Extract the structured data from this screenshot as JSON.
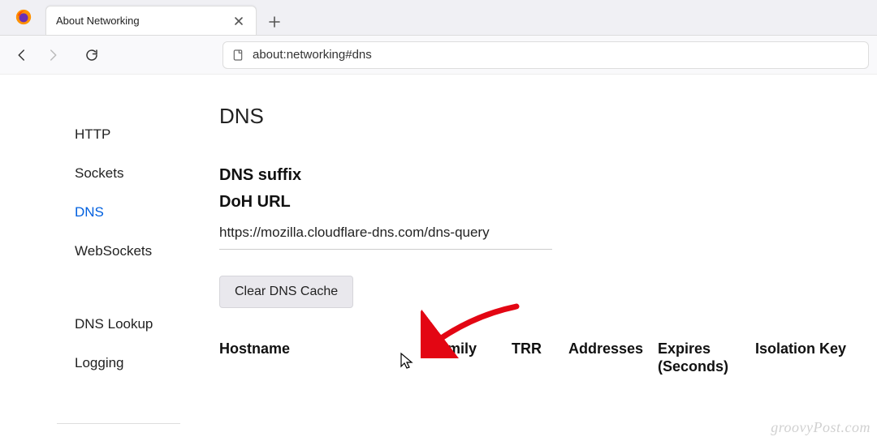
{
  "tab": {
    "title": "About Networking"
  },
  "url": "about:networking#dns",
  "sidebar": {
    "items": [
      {
        "label": "HTTP"
      },
      {
        "label": "Sockets"
      },
      {
        "label": "DNS"
      },
      {
        "label": "WebSockets"
      },
      {
        "label": "DNS Lookup"
      },
      {
        "label": "Logging"
      }
    ],
    "active_index": 2
  },
  "main": {
    "title": "DNS",
    "dns_suffix_label": "DNS suffix",
    "doh_label": "DoH URL",
    "doh_value": "https://mozilla.cloudflare-dns.com/dns-query",
    "clear_button": "Clear DNS Cache",
    "columns": {
      "hostname": "Hostname",
      "family": "Family",
      "trr": "TRR",
      "addresses": "Addresses",
      "expires": "Expires (Seconds)",
      "isolation": "Isolation Key"
    }
  },
  "watermark": "groovyPost.com"
}
